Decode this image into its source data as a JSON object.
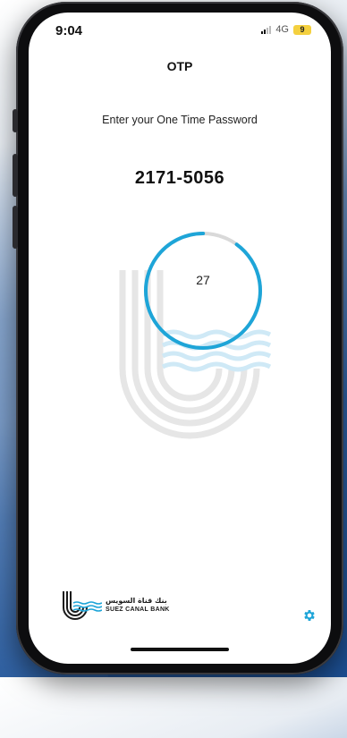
{
  "status_bar": {
    "time": "9:04",
    "network": "4G",
    "battery": "9",
    "battery_color": "#f4d03f"
  },
  "header": {
    "title": "OTP"
  },
  "main": {
    "prompt": "Enter your One Time Password",
    "otp_code": "2171-5056",
    "timer": {
      "seconds_remaining": "27",
      "progress_fraction": 0.9,
      "ring_color": "#1ea5d8",
      "track_color": "#d9d9d9"
    }
  },
  "footer": {
    "logo_text_ar": "بنك قناة السويس",
    "logo_text_en": "SUEZ CANAL BANK",
    "settings_icon": "gear-icon",
    "accent_color": "#1ea5d8"
  }
}
